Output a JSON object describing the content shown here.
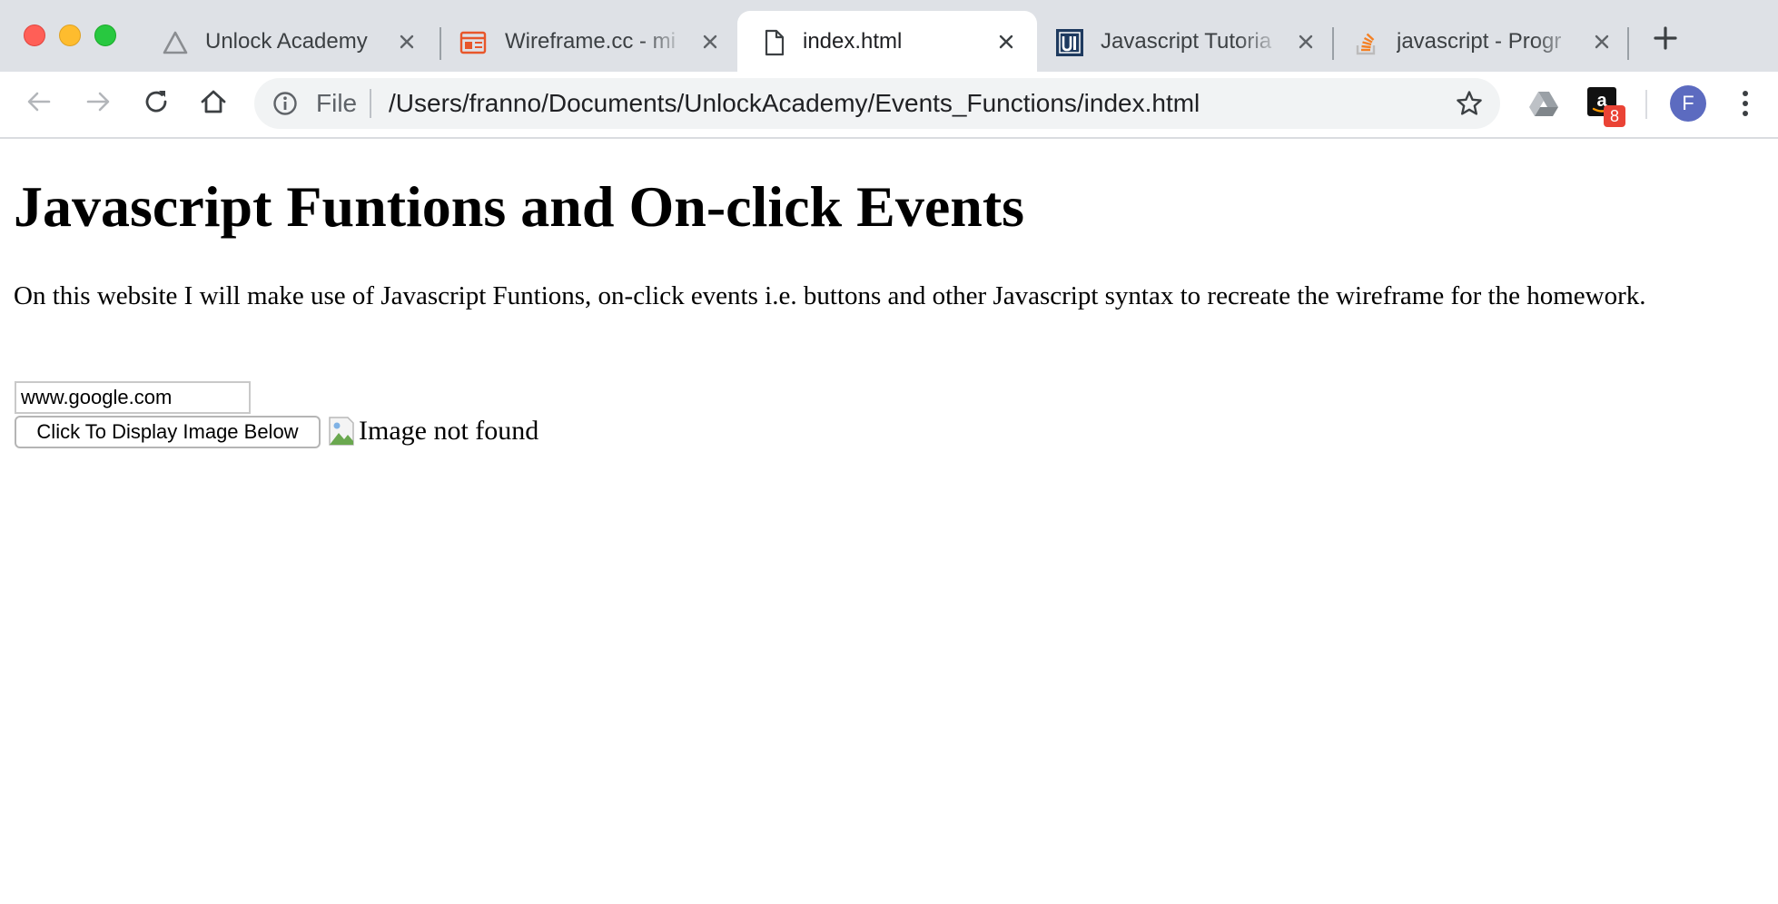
{
  "window": {
    "controls": [
      "close",
      "minimize",
      "zoom"
    ]
  },
  "tabs": [
    {
      "title": "Unlock Academy",
      "icon": "triangle-icon",
      "active": false
    },
    {
      "title": "Wireframe.cc - mi",
      "icon": "wireframe-icon",
      "active": false
    },
    {
      "title": "index.html",
      "icon": "document-icon",
      "active": true
    },
    {
      "title": "Javascript Tutoria",
      "icon": "ui-logo-icon",
      "active": false
    },
    {
      "title": "javascript - Progr",
      "icon": "stackoverflow-icon",
      "active": false
    }
  ],
  "new_tab_icon": "plus-icon",
  "toolbar": {
    "back_icon": "arrow-left-icon",
    "forward_icon": "arrow-right-icon",
    "reload_icon": "reload-icon",
    "home_icon": "home-icon",
    "address": {
      "scheme_label": "File",
      "url": "/Users/franno/Documents/UnlockAcademy/Events_Functions/index.html"
    },
    "extensions": {
      "amazon_badge": "8"
    },
    "profile_initial": "F"
  },
  "colors": {
    "tabstrip_bg": "#dee1e6",
    "omnibox_bg": "#f1f3f4",
    "avatar_bg": "#5c6bc0",
    "badge_bg": "#ea4335",
    "wireframe_orange": "#e8562a",
    "stackoverflow_orange": "#f48024",
    "ui_blue": "#1e3a5f"
  },
  "page": {
    "heading": "Javascript Funtions and On-click Events",
    "paragraph": "On this website I will make use of Javascript Funtions, on-click events i.e. buttons and other Javascript syntax to recreate the wireframe for the homework.",
    "url_input_value": "www.google.com",
    "display_button_label": "Click To Display Image Below",
    "image_alt_text": "Image not found"
  }
}
